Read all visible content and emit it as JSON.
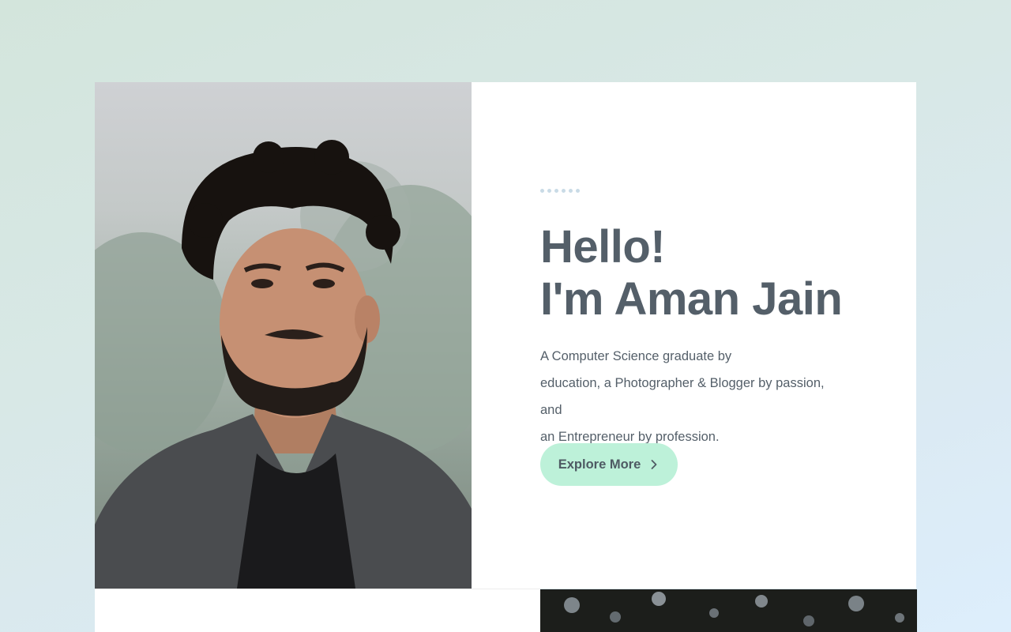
{
  "hero": {
    "portrait_alt": "portrait-photo",
    "greeting": "Hello!",
    "name_line": "I'm Aman Jain",
    "bio_lines": [
      "A Computer Science graduate by",
      "education, a Photographer & Blogger by passion, and",
      "an Entrepreneur by profession."
    ],
    "cta_label": "Explore More",
    "cta_icon": "chevron-right-icon"
  },
  "colors": {
    "accent": "#bdf1d9",
    "text": "#545f69",
    "dots": "#c9dbe6"
  }
}
